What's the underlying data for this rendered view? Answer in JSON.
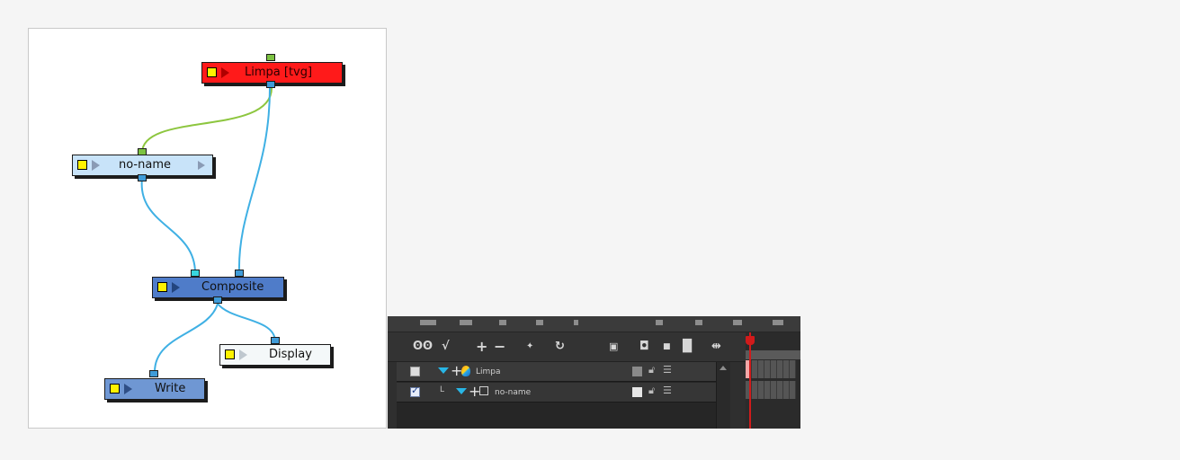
{
  "node_view": {
    "nodes": {
      "limpa": {
        "label": "Limpa  [tvg]",
        "color": "#ff1a1a"
      },
      "noname": {
        "label": "no-name",
        "color": "#c8e3f9"
      },
      "composite": {
        "label": "Composite",
        "color": "#4f7cc9"
      },
      "display": {
        "label": "Display",
        "color": "#f4f8f9"
      },
      "write": {
        "label": "Write",
        "color": "#6f97d3"
      }
    },
    "colors": {
      "wire_blue": "#3fb0e4",
      "wire_green": "#8dc63f",
      "port_green": "#7cc242",
      "port_blue": "#3f9bd8",
      "port_cyan": "#38d6de"
    }
  },
  "timeline": {
    "toolbar_icons": [
      "onion-skin-icon",
      "onion-skin-add-icon",
      "add-layer-icon",
      "remove-layer-icon",
      "add-drawing-icon",
      "add-peg-icon",
      "show-thumbnails-icon",
      "layer-properties-icon",
      "small-square-icon",
      "large-square-icon",
      "expand-frames-icon"
    ],
    "layers": [
      {
        "name": "Limpa",
        "checked": false,
        "swatch_color": "#8a8a8a",
        "icon": "drawing-layer-icon"
      },
      {
        "name": "no-name",
        "checked": true,
        "swatch_color": "#e6e6e6",
        "icon": "group-layer-icon",
        "prefix": "L"
      }
    ]
  }
}
